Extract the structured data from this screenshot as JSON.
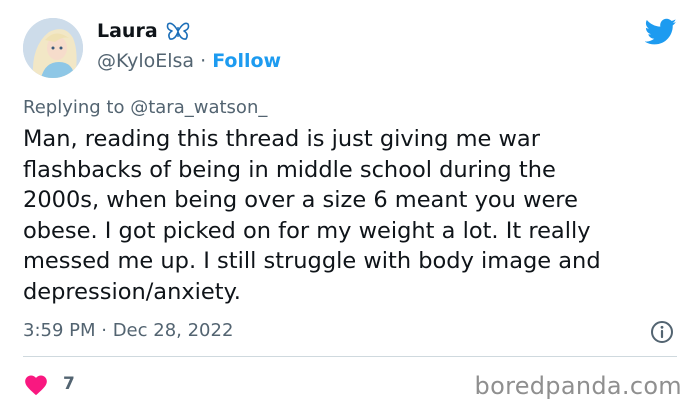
{
  "author": {
    "name": "Laura",
    "handle": "@KyloElsa",
    "separator": "·",
    "follow_label": "Follow"
  },
  "reply": {
    "prefix": "Replying to",
    "to": "@tara_watson_"
  },
  "tweet": {
    "text": "Man, reading this thread is just giving me war\nflashbacks of being in middle school during the\n2000s, when being over a size 6 meant you were\nobese. I got picked on for my weight a lot. It really\nmessed me up. I still struggle with body image and\ndepression/anxiety.",
    "timestamp": "3:59 PM · Dec 28, 2022",
    "likes": "7"
  },
  "watermark": "boredpanda.com",
  "icons": {
    "badge": "butterfly-icon",
    "brand": "twitter-bird-icon",
    "info": "info-icon",
    "like": "heart-icon"
  },
  "colors": {
    "accent": "#1d9bf0",
    "like": "#f91880",
    "secondary_text": "#536471"
  }
}
